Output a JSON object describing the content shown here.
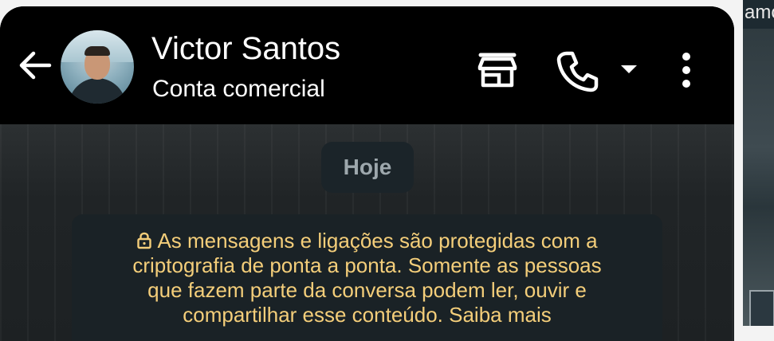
{
  "header": {
    "contact_name": "Victor Santos",
    "contact_subtitle": "Conta comercial",
    "icons": {
      "back": "arrow-left-icon",
      "store": "storefront-icon",
      "call": "phone-icon",
      "dropdown": "caret-down-icon",
      "more": "more-vertical-icon"
    }
  },
  "chat": {
    "date_label": "Hoje",
    "encryption_notice": {
      "icon": "lock-icon",
      "lines": [
        "As mensagens e ligações são protegidas com a",
        "criptografia de ponta a ponta. Somente as pessoas",
        "que fazem parte da conversa podem ler, ouvir e",
        "compartilhar esse conteúdo. Saiba mais"
      ]
    }
  },
  "right_peek": {
    "text": "amo"
  },
  "colors": {
    "header_background": "#000000",
    "notice_text": "#f4ce7a",
    "date_chip_background": "#1b2429",
    "notice_background": "#1a2226"
  }
}
